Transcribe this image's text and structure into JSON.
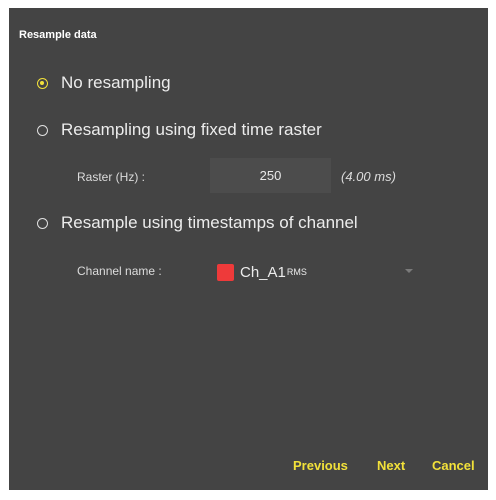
{
  "dialog": {
    "title": "Resample data",
    "options": [
      {
        "label": "No resampling",
        "selected": true
      },
      {
        "label": "Resampling using fixed time raster",
        "selected": false
      },
      {
        "label": "Resample using timestamps of channel",
        "selected": false
      }
    ],
    "raster": {
      "label": "Raster (Hz) :",
      "value": "250",
      "ms_text": "(4.00 ms)"
    },
    "channel": {
      "label": "Channel name :",
      "name": "Ch_A1",
      "subscript": "RMS",
      "color": "#ee3a3a"
    },
    "buttons": {
      "previous": "Previous",
      "next": "Next",
      "cancel": "Cancel"
    }
  },
  "colors": {
    "background": "#444444",
    "accent": "#f2e13a"
  }
}
